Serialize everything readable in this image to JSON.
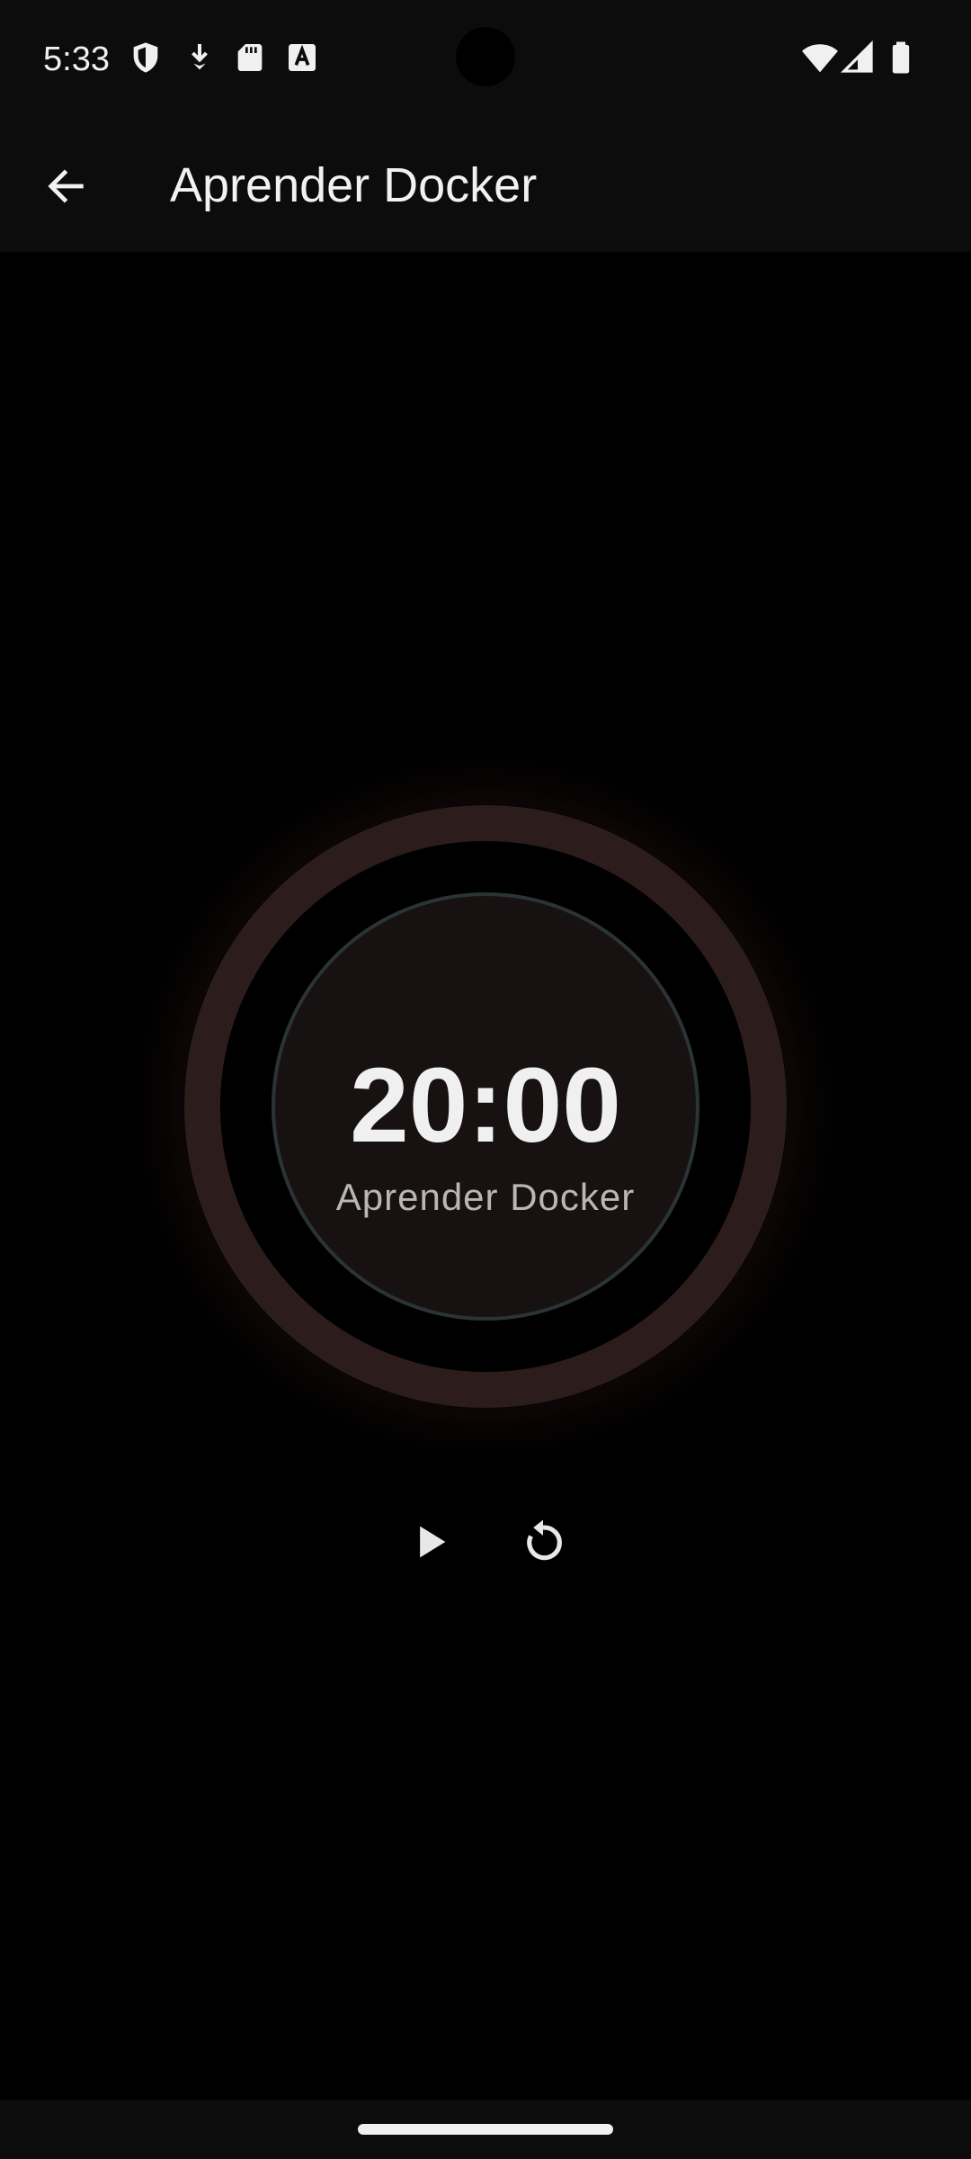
{
  "status_bar": {
    "time": "5:33",
    "left_icons": [
      "vpn-shield-icon",
      "download-icon",
      "sd-card-icon",
      "text-a-icon"
    ],
    "right_icons": [
      "wifi-icon",
      "cell-signal-icon",
      "battery-icon"
    ]
  },
  "app_bar": {
    "back_icon": "arrow-back-icon",
    "title": "Aprender Docker"
  },
  "timer": {
    "time": "20:00",
    "label": "Aprender Docker",
    "progress": 0,
    "colors": {
      "outer_ring": "#2c1c1c",
      "inner_disk": "#181112",
      "inner_border": "#2a3436"
    }
  },
  "controls": {
    "play_icon": "play-icon",
    "reset_icon": "reset-icon"
  },
  "colors": {
    "background": "#000000",
    "bars": "#0c0c0c",
    "text": "#f0f0f0"
  }
}
